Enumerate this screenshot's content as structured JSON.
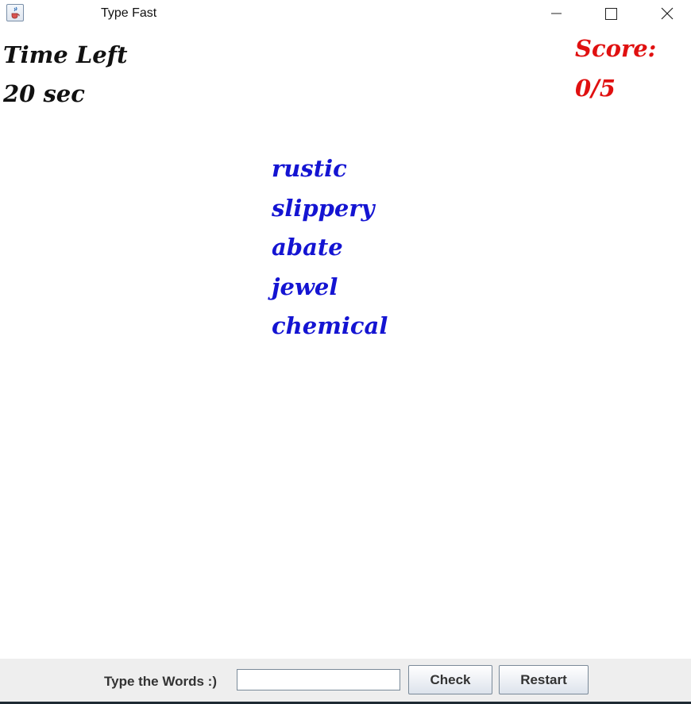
{
  "window": {
    "title": "Type Fast",
    "app_icon": "java-cup-icon",
    "controls": {
      "minimize": "minimize-icon",
      "maximize": "maximize-icon",
      "close": "close-icon"
    }
  },
  "timer": {
    "label": "Time Left",
    "value": "20 sec"
  },
  "score": {
    "label": "Score:",
    "value": "0/5"
  },
  "words": [
    "rustic",
    "slippery",
    "abate",
    "jewel",
    "chemical"
  ],
  "input_bar": {
    "prompt": "Type the Words :)",
    "input_value": "",
    "check_label": "Check",
    "restart_label": "Restart"
  },
  "colors": {
    "score": "#e01010",
    "words": "#1414d2",
    "timer": "#111111",
    "bottom_bar": "#eeeeee"
  }
}
